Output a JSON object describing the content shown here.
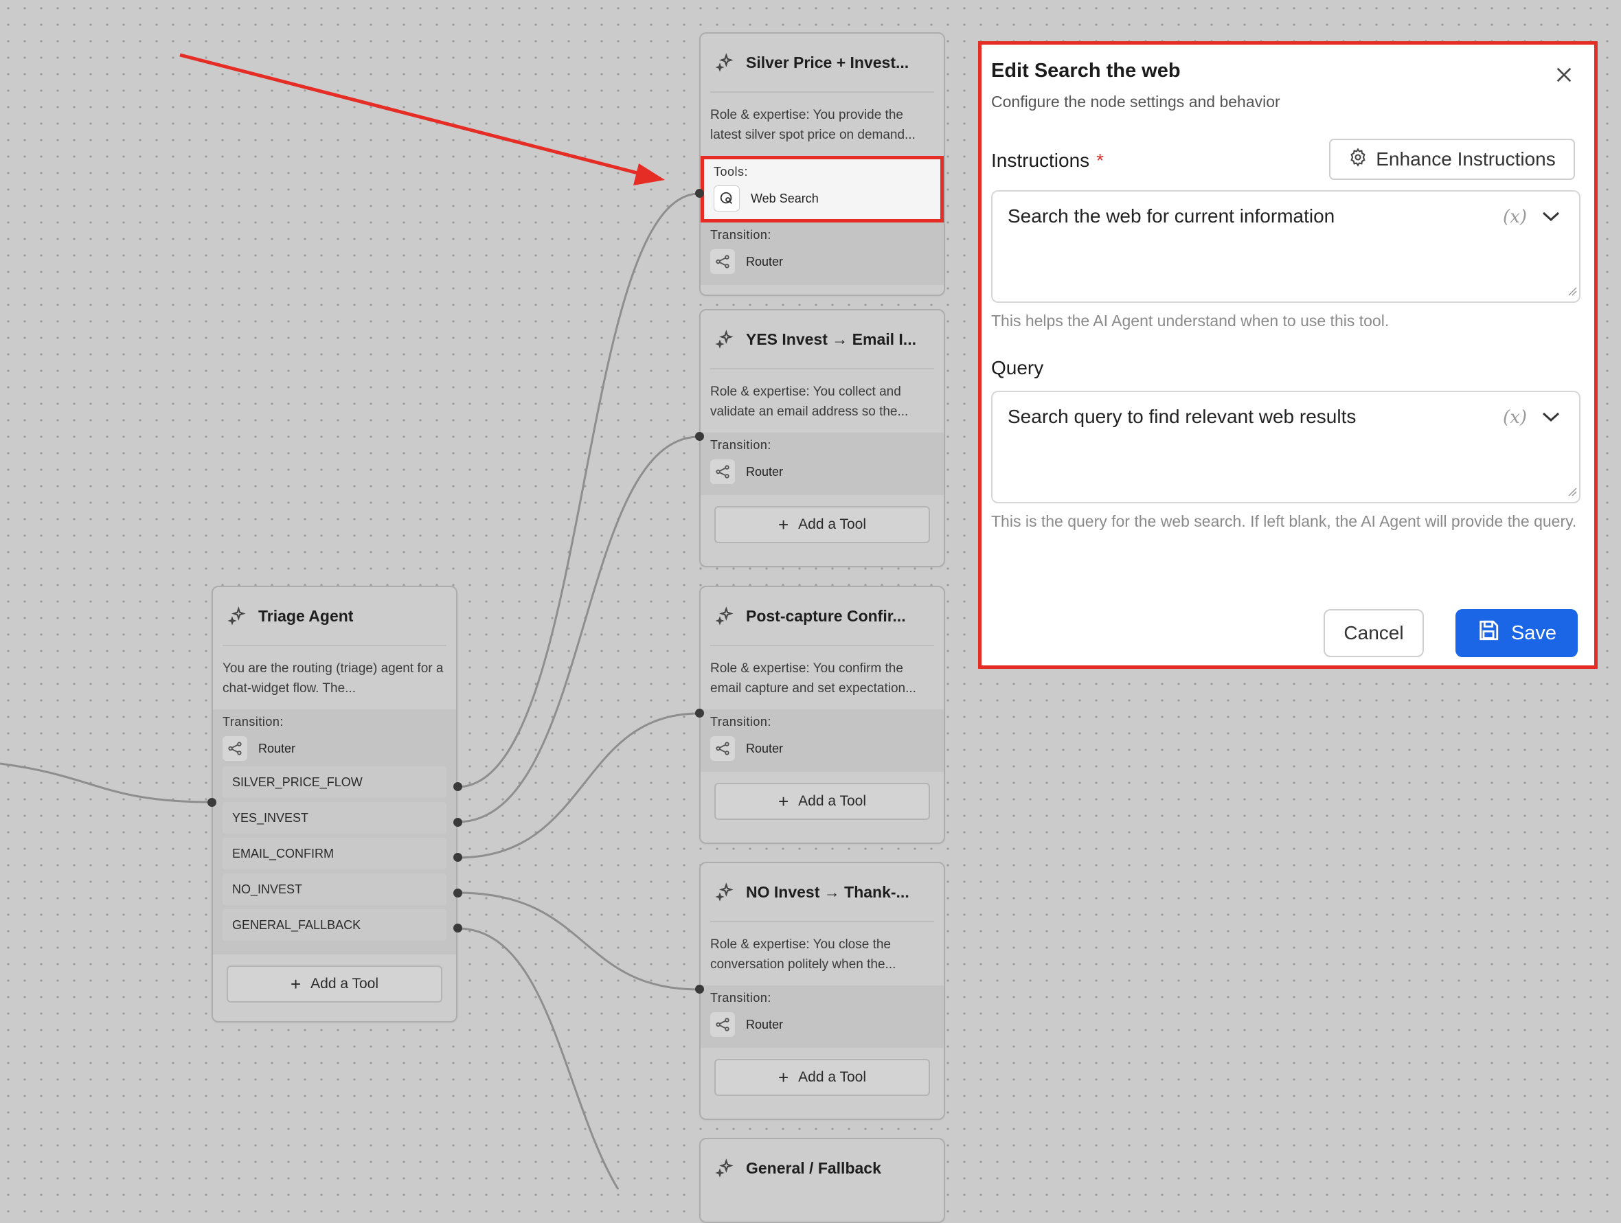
{
  "canvas": {
    "nodes": {
      "silver": {
        "title": "Silver Price + Invest...",
        "desc": "Role & expertise: You provide the latest silver spot price on demand...",
        "tools_label": "Tools:",
        "tool": "Web Search",
        "transition_label": "Transition:",
        "router": "Router"
      },
      "yes_invest": {
        "title": "YES Invest → Email I...",
        "desc": "Role & expertise: You collect and validate an email address so the...",
        "transition_label": "Transition:",
        "router": "Router",
        "add_tool": "Add a Tool"
      },
      "post_capture": {
        "title": "Post-capture Confir...",
        "desc": "Role & expertise: You confirm the email capture and set expectation...",
        "transition_label": "Transition:",
        "router": "Router",
        "add_tool": "Add a Tool"
      },
      "no_invest": {
        "title": "NO Invest → Thank-...",
        "desc": "Role & expertise: You close the conversation politely when the...",
        "transition_label": "Transition:",
        "router": "Router",
        "add_tool": "Add a Tool"
      },
      "fallback": {
        "title": "General / Fallback"
      },
      "triage": {
        "title": "Triage Agent",
        "desc": "You are the routing (triage) agent for a chat-widget flow. The...",
        "transition_label": "Transition:",
        "router": "Router",
        "routes": [
          "SILVER_PRICE_FLOW",
          "YES_INVEST",
          "EMAIL_CONFIRM",
          "NO_INVEST",
          "GENERAL_FALLBACK"
        ],
        "add_tool": "Add a Tool"
      }
    }
  },
  "panel": {
    "title": "Edit Search the web",
    "subtitle": "Configure the node settings and behavior",
    "instructions_label": "Instructions",
    "required_mark": "*",
    "enhance_button": "Enhance Instructions",
    "instructions_value": "Search the web for current information",
    "instructions_hint": "This helps the AI Agent understand when to use this tool.",
    "query_label": "Query",
    "query_value": "Search query to find relevant web results",
    "query_hint": "This is the query for the web search. If left blank, the AI Agent will provide the query.",
    "variable_token": "(x)",
    "cancel_button": "Cancel",
    "save_button": "Save"
  },
  "colors": {
    "highlight": "#e52d26",
    "primary": "#1b66e6",
    "canvas_bg": "#cbcbcb"
  }
}
